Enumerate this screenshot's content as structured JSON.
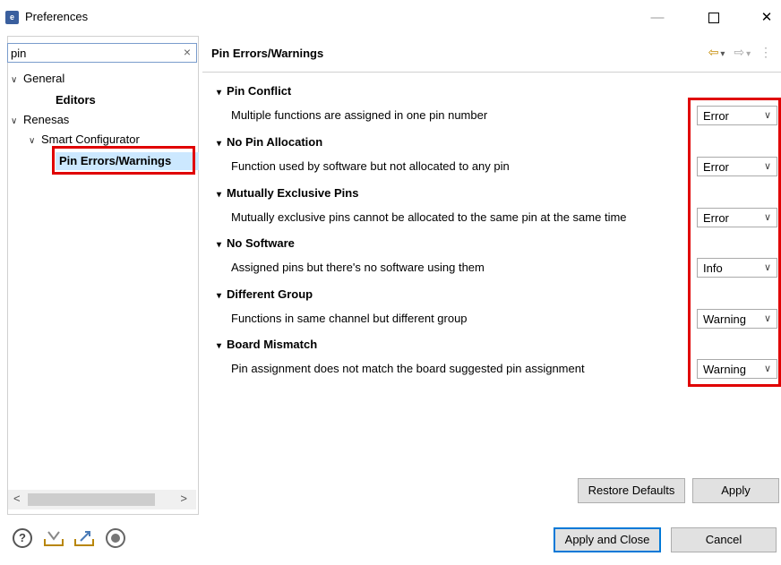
{
  "window": {
    "title": "Preferences",
    "minimize": "—",
    "close": "✕"
  },
  "filter": {
    "value": "pin",
    "clear": "×"
  },
  "tree": {
    "items": [
      {
        "label": "General",
        "chevron": "∨"
      },
      {
        "label": "Editors"
      },
      {
        "label": "Renesas",
        "chevron": "∨"
      },
      {
        "label": "Smart Configurator",
        "chevron": "∨"
      },
      {
        "label": "Pin Errors/Warnings",
        "selected": true
      }
    ]
  },
  "page": {
    "title": "Pin Errors/Warnings",
    "sections": [
      {
        "heading": "Pin Conflict",
        "description": "Multiple functions are assigned in one pin number",
        "severity": "Error"
      },
      {
        "heading": "No Pin Allocation",
        "description": "Function used by software but not allocated to any pin",
        "severity": "Error"
      },
      {
        "heading": "Mutually Exclusive Pins",
        "description": "Mutually exclusive pins cannot be allocated to the same pin at the same time",
        "severity": "Error"
      },
      {
        "heading": "No Software",
        "description": "Assigned pins but there's no software using them",
        "severity": "Info"
      },
      {
        "heading": "Different Group",
        "description": "Functions in same channel but different group",
        "severity": "Warning"
      },
      {
        "heading": "Board Mismatch",
        "description": "Pin assignment does not match the board suggested pin assignment",
        "severity": "Warning"
      }
    ]
  },
  "buttons": {
    "restore_defaults": "Restore Defaults",
    "apply": "Apply",
    "apply_and_close": "Apply and Close",
    "cancel": "Cancel"
  },
  "icons": {
    "section_toggle": "▾",
    "combo_arrow": "∨",
    "back": "⇦",
    "forward": "⇨",
    "dropdown": "▾",
    "menu": "⋮",
    "help": "?"
  },
  "colors": {
    "highlight": "#e00000",
    "selection": "#cce8ff",
    "default_button_border": "#0078d7"
  }
}
